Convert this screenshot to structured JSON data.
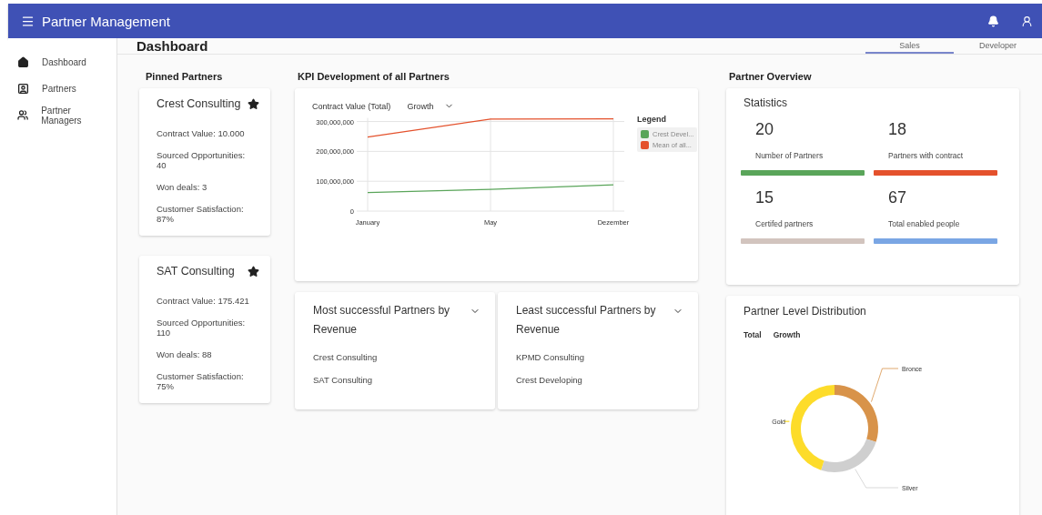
{
  "app_bar": {
    "title": "Partner Management"
  },
  "sidebar": {
    "items": [
      {
        "label": "Dashboard",
        "selected": false
      },
      {
        "label": "Partners",
        "selected": false
      },
      {
        "label": "Partner Managers",
        "selected": false
      }
    ]
  },
  "header": {
    "title": "Dashboard",
    "tabs": [
      {
        "label": "Sales",
        "selected": true
      },
      {
        "label": "Developer",
        "selected": false
      }
    ]
  },
  "pinned": {
    "title": "Pinned Partners",
    "cards": [
      {
        "name": "Crest Consulting",
        "pinned": true,
        "facts": [
          "Contract Value: 10.000",
          "Sourced Opportunities: 40",
          "Won deals: 3",
          "Customer Satisfaction: 87%"
        ]
      },
      {
        "name": "SAT Consulting",
        "pinned": true,
        "facts": [
          "Contract Value: 175.421",
          "Sourced Opportunities: 110",
          "Won deals: 88",
          "Customer Satisfaction: 75%"
        ]
      }
    ]
  },
  "kpi": {
    "title": "KPI Development of all Partners",
    "metric": "Contract Value (Total)",
    "mode": "Growth",
    "legend_title": "Legend",
    "chart_data": {
      "type": "line",
      "categories": [
        "January",
        "May",
        "Dezember"
      ],
      "ylim": [
        0,
        320000000
      ],
      "grid": true,
      "yticks": [
        {
          "value": 0,
          "label": "0"
        },
        {
          "value": 100000000,
          "label": "100,000,000"
        },
        {
          "value": 200000000,
          "label": "200,000,000"
        },
        {
          "value": 300000000,
          "label": "300,000,000"
        }
      ],
      "series": [
        {
          "name": "Crest Devel...",
          "color": "#5aa55a",
          "values": [
            62000000,
            73000000,
            88000000
          ]
        },
        {
          "name": "Mean of all...",
          "color": "#e4512c",
          "values": [
            248000000,
            308000000,
            309000000
          ]
        }
      ]
    }
  },
  "lists": [
    {
      "title": "Most successful Partners by Revenue",
      "items": [
        "Crest Consulting",
        "SAT Consulting"
      ]
    },
    {
      "title": "Least successful Partners by Revenue",
      "items": [
        "KPMD Consulting",
        "Crest Developing"
      ]
    }
  ],
  "overview": {
    "title": "Partner Overview",
    "statistics": {
      "title": "Statistics",
      "stats": [
        {
          "value": "20",
          "label": "Number of Partners",
          "color": "#5aa55a"
        },
        {
          "value": "18",
          "label": "Partners with contract",
          "color": "#e4512c"
        },
        {
          "value": "15",
          "label": "Certifed partners",
          "color": "#d2c4be"
        },
        {
          "value": "67",
          "label": "Total enabled people",
          "color": "#7aa6e4"
        }
      ]
    },
    "distribution": {
      "title": "Partner Level Distribution",
      "toggles": [
        "Total",
        "Growth"
      ],
      "chart_data": {
        "type": "donut",
        "categories": [
          "Bronce",
          "Silver",
          "Gold"
        ],
        "values": [
          30,
          25,
          45
        ],
        "colors": [
          "#d8934a",
          "#cfcfcf",
          "#fddc2a"
        ]
      }
    }
  }
}
